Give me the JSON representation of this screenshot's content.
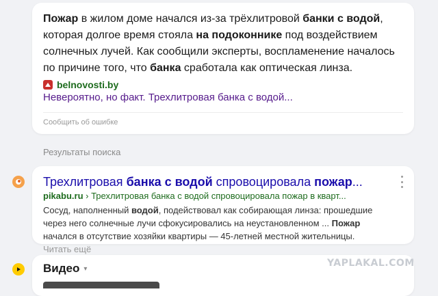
{
  "snippet": {
    "text_parts": {
      "p1": "Пожар",
      "p2": " в жилом доме начался из-за трёхлитровой ",
      "p3": "банки с водой",
      "p4": ", которая долгое время стояла ",
      "p5": "на подоконнике",
      "p6": " под воздействием солнечных лучей. Как сообщили эксперты, воспламенение началось по причине того, что ",
      "p7": "банка",
      "p8": " сработала как оптическая линза."
    },
    "source_domain": "belnovosti.by",
    "source_title": "Невероятно, но факт. Трехлитровая банка с водой...",
    "report_label": "Сообщить об ошибке"
  },
  "section_header": "Результаты поиска",
  "result": {
    "title_parts": {
      "t1": "Трехлитровая ",
      "t2": "банка с водой",
      "t3": " спровоцировала ",
      "t4": "пожар",
      "t5": "..."
    },
    "url_parts": {
      "u1": "pikabu.ru",
      "u2": " › Трехлитровая банка с водой спровоцировала пожар в кварт..."
    },
    "desc_parts": {
      "d1": "Сосуд, наполненный ",
      "d2": "водой",
      "d3": ", подействовал как собирающая линза: прошедшие через него солнечные лучи сфокусировались на неустановленном ... ",
      "d4": "Пожар",
      "d5": " начался в отсутствие хозяйки квартиры — 45-летней местной жительницы. ",
      "more": "Читать ещё"
    }
  },
  "video": {
    "title": "Видео",
    "caret": "▾"
  },
  "watermark": "YAPLAKAL.COM",
  "icons": {
    "belnovosti": "belnovosti-favicon",
    "pikabu": "pikabu-favicon",
    "video": "play-icon",
    "menu": "kebab-menu-icon"
  },
  "colors": {
    "link_title": "#1a0dab",
    "visited_title": "#551a8b",
    "url_green": "#1d6b1d",
    "page_bg": "#f1f2f5"
  }
}
